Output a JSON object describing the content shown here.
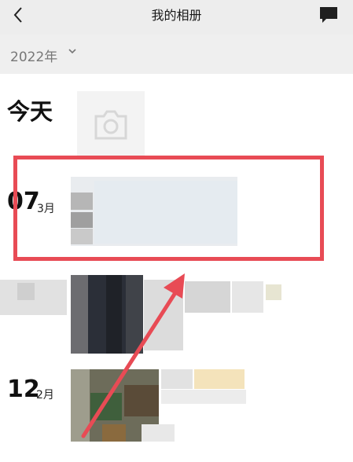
{
  "header": {
    "title": "我的相册",
    "back_icon": "chevron-left-icon",
    "chat_icon": "chat-bubble-icon"
  },
  "year_filter": {
    "label": "2022年",
    "icon": "chevron-down-icon"
  },
  "sections": [
    {
      "title": "今天",
      "action_icon": "camera-icon"
    },
    {
      "day": "07",
      "month": "3月"
    },
    {
      "day": "12",
      "month": "2月"
    }
  ],
  "annotation": {
    "box_color": "#e84b55",
    "arrow_color": "#e84b55"
  }
}
